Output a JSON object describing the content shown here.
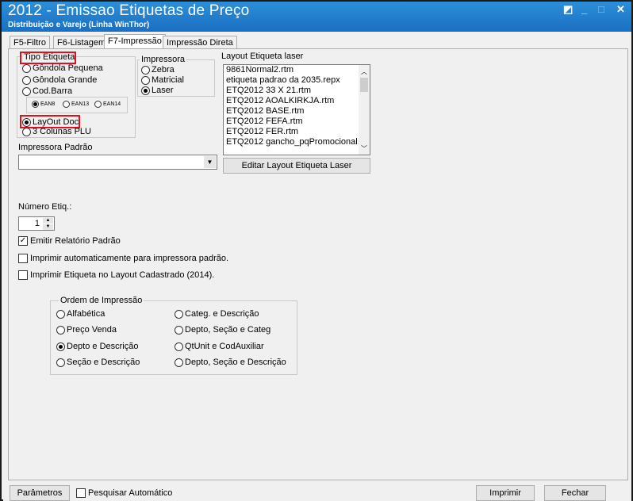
{
  "window": {
    "title": "2012 - Emissao Etiquetas de Preço",
    "subtitle": "Distribuição e Varejo (Linha WinThor)",
    "controls": [
      "◩",
      "_",
      "□",
      "✕"
    ]
  },
  "tabs": [
    "F5-Filtro",
    "F6-Listagem",
    "F7-Impressão",
    "Impressão Direta"
  ],
  "tipo_etiqueta": {
    "label": "Tipo Etiqueta",
    "options": [
      "Gôndola Pequena",
      "Gôndola Grande",
      "Cod.Barra",
      "LayOut Doc",
      "3 Colunas PLU"
    ],
    "selected": "LayOut Doc",
    "ean_options": [
      "EAN8",
      "EAN13",
      "EAN14"
    ],
    "ean_selected": "EAN8"
  },
  "impressora": {
    "label": "Impressora",
    "options": [
      "Zebra",
      "Matricial",
      "Laser"
    ],
    "selected": "Laser"
  },
  "layout": {
    "label": "Layout Etiqueta laser",
    "items": [
      "9861Normal2.rtm",
      "etiqueta padrao da 2035.repx",
      "ETQ2012 33 X 21.rtm",
      "ETQ2012 AOALKIRKJA.rtm",
      "ETQ2012 BASE.rtm",
      "ETQ2012 FEFA.rtm",
      "ETQ2012 FER.rtm",
      "ETQ2012 gancho_pqPromocional.rtm"
    ],
    "edit_button": "Editar Layout Etiqueta Laser"
  },
  "impressora_padrao": {
    "label": "Impressora Padrão",
    "value": ""
  },
  "numero_etiq": {
    "label": "Número Etiq.:",
    "value": "1"
  },
  "checks": [
    {
      "label": "Emitir Relatório Padrão",
      "checked": true
    },
    {
      "label": "Imprimir automaticamente para impressora padrão.",
      "checked": false
    },
    {
      "label": "Imprimir Etiqueta no Layout Cadastrado (2014).",
      "checked": false
    }
  ],
  "ordem": {
    "label": "Ordem de Impressão",
    "col1": [
      "Alfabética",
      "Preço Venda",
      "Depto e Descrição",
      "Seção e Descrição"
    ],
    "col2": [
      "Categ. e Descrição",
      "Depto, Seção e Categ",
      "QtUnit e CodAuxiliar",
      "Depto, Seção e Descrição"
    ],
    "selected": "Depto e Descrição"
  },
  "bottom": {
    "parametros": "Parâmetros",
    "pesquisar": "Pesquisar Automático",
    "pesquisar_checked": false,
    "imprimir": "Imprimir",
    "fechar": "Fechar"
  },
  "colors": {
    "titlebar": "#1a6fc0",
    "highlight": "#e0101e"
  }
}
